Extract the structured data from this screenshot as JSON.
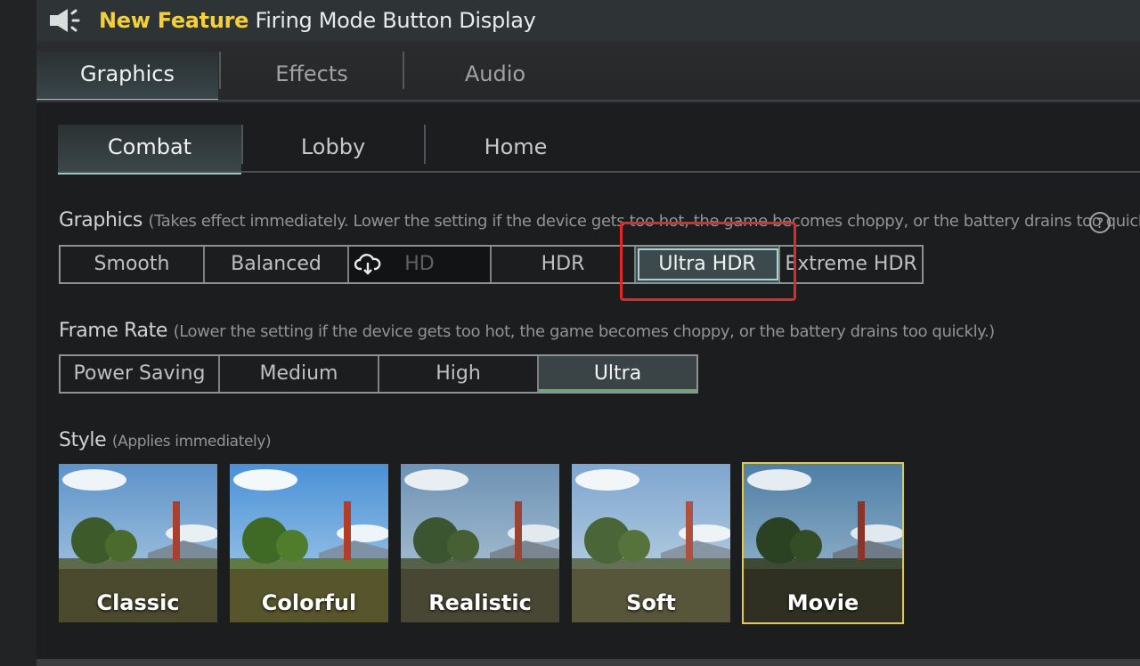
{
  "banner": {
    "new_label": "New Feature",
    "title": "Firing Mode Button Display",
    "icon": "speaker-icon"
  },
  "main_tabs": [
    {
      "label": "Graphics",
      "active": true
    },
    {
      "label": "Effects",
      "active": false
    },
    {
      "label": "Audio",
      "active": false
    }
  ],
  "sub_tabs": [
    {
      "label": "Combat",
      "active": true
    },
    {
      "label": "Lobby",
      "active": false
    },
    {
      "label": "Home",
      "active": false
    }
  ],
  "graphics": {
    "label": "Graphics",
    "note": "(Takes effect immediately. Lower the setting if the device gets too hot, the game becomes choppy, or the battery drains too quickly.)",
    "help_icon": "help-icon",
    "options": [
      "Smooth",
      "Balanced",
      "HD",
      "HDR",
      "Ultra HDR",
      "Extreme HDR"
    ],
    "selected": "Ultra HDR",
    "download_icon": "cloud-download-icon"
  },
  "frame_rate": {
    "label": "Frame Rate",
    "note": "(Lower the setting if the device gets too hot, the game becomes choppy, or the battery drains too quickly.)",
    "options": [
      "Power Saving",
      "Medium",
      "High",
      "Ultra"
    ],
    "selected": "Ultra"
  },
  "style": {
    "label": "Style",
    "note": "(Applies immediately)",
    "options": [
      "Classic",
      "Colorful",
      "Realistic",
      "Soft",
      "Movie"
    ],
    "selected": "Movie"
  },
  "colors": {
    "accent_yellow": "#f2cf3b",
    "selection_teal": "#97c8c6",
    "highlight_red": "#e32626"
  }
}
